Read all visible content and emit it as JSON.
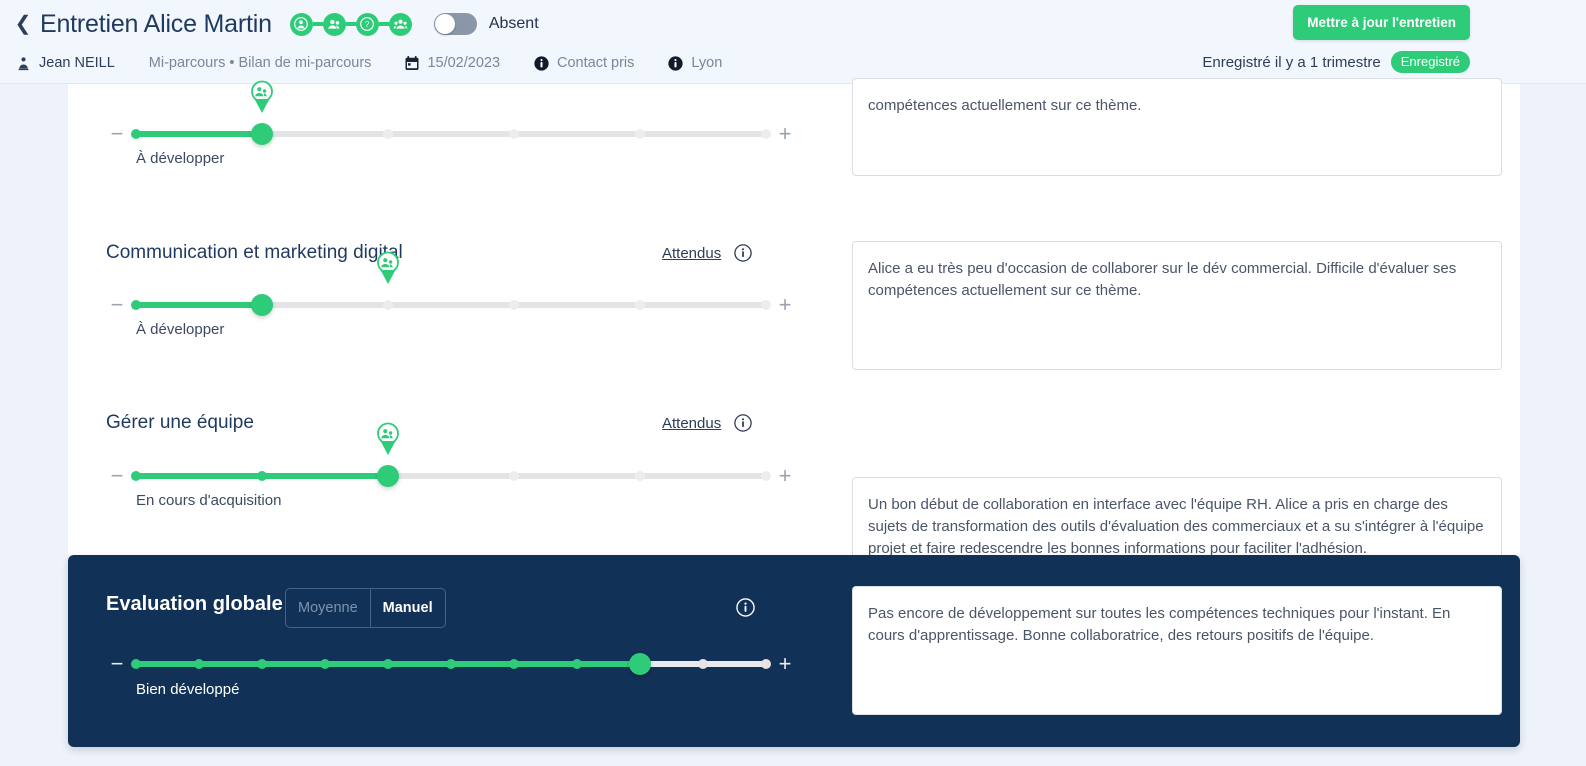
{
  "header": {
    "back_icon": "chevron-left-icon",
    "title": "Entretien Alice Martin",
    "steps": [
      {
        "icon": "person-circle-icon"
      },
      {
        "icon": "people-icon"
      },
      {
        "icon": "question-bubble-icon"
      },
      {
        "icon": "group-icon"
      }
    ],
    "absent_toggle_label": "Absent",
    "absent_toggle_on": false,
    "meta": {
      "manager_icon": "manager-icon",
      "manager": "Jean NEILL",
      "campaign": "Mi-parcours • Bilan de mi-parcours",
      "date_icon": "calendar-icon",
      "date": "15/02/2023",
      "status_icon": "info-filled-icon",
      "status": "Contact pris",
      "location_icon": "info-filled-icon",
      "location": "Lyon"
    },
    "update_button": "Mettre à jour l'entretien",
    "saved_text": "Enregistré il y a 1 trimestre",
    "saved_badge": "Enregistré"
  },
  "accent_green": "#2ecc79",
  "panel_navy": "#123156",
  "page_background": "#eef2fb",
  "competencies": [
    {
      "title": "",
      "attendus_label": "",
      "info_icon": "info-outline-icon",
      "slider": {
        "steps": 6,
        "value": 1,
        "marker": 1,
        "marker_icon": "people-pin-icon",
        "minus_icon": "minus-icon",
        "plus_icon": "plus-icon",
        "caption": "À développer"
      },
      "comment": "compétences actuellement sur ce thème."
    },
    {
      "title": "Communication et marketing digital",
      "attendus_label": "Attendus",
      "info_icon": "info-outline-icon",
      "slider": {
        "steps": 6,
        "value": 1,
        "marker": 2,
        "marker_icon": "people-pin-icon",
        "minus_icon": "minus-icon",
        "plus_icon": "plus-icon",
        "caption": "À développer"
      },
      "comment": "Alice a eu très peu d'occasion de collaborer sur le dév commercial. Difficile d'évaluer ses compétences actuellement sur ce thème."
    },
    {
      "title": "Gérer une équipe",
      "attendus_label": "Attendus",
      "info_icon": "info-outline-icon",
      "slider": {
        "steps": 6,
        "value": 2,
        "marker": 2,
        "marker_icon": "people-pin-icon",
        "minus_icon": "minus-icon",
        "plus_icon": "plus-icon",
        "caption": "En cours d'acquisition"
      },
      "comment": "Un bon début de collaboration en interface avec l'équipe RH. Alice a pris en charge des sujets de transformation des outils d'évaluation des commerciaux et a su s'intégrer à l'équipe projet et faire redescendre les bonnes informations pour faciliter l'adhésion."
    }
  ],
  "global": {
    "title": "Evaluation globale",
    "mode_options": [
      "Moyenne",
      "Manuel"
    ],
    "mode_selected": "Manuel",
    "info_icon": "info-outline-icon",
    "slider": {
      "steps": 11,
      "value": 8,
      "minus_icon": "minus-icon",
      "plus_icon": "plus-icon",
      "caption": "Bien développé"
    },
    "comment": "Pas encore de développement sur toutes  les compétences techniques pour l'instant. En cours d'apprentissage. Bonne collaboratrice, des retours positifs de l'équipe."
  }
}
